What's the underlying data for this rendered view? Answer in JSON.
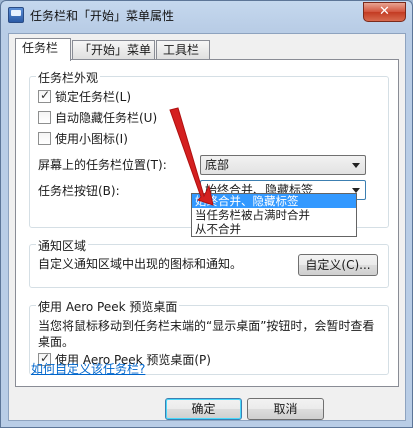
{
  "window": {
    "title": "任务栏和「开始」菜单属性",
    "close_symbol": "✕"
  },
  "tabs": [
    {
      "label": "任务栏",
      "active": true
    },
    {
      "label": "「开始」菜单",
      "active": false
    },
    {
      "label": "工具栏",
      "active": false
    }
  ],
  "appearance": {
    "group_title": "任务栏外观",
    "lock_taskbar": {
      "label": "锁定任务栏(L)",
      "checked": true
    },
    "auto_hide": {
      "label": "自动隐藏任务栏(U)",
      "checked": false
    },
    "small_icons": {
      "label": "使用小图标(I)",
      "checked": false
    },
    "location_label": "屏幕上的任务栏位置(T):",
    "location_value": "底部",
    "buttons_label": "任务栏按钮(B):",
    "buttons_value": "始终合并、隐藏标签",
    "buttons_options": [
      {
        "label": "始终合并、隐藏标签",
        "selected": true
      },
      {
        "label": "当任务栏被占满时合并",
        "selected": false
      },
      {
        "label": "从不合并",
        "selected": false
      }
    ]
  },
  "notification": {
    "group_title": "通知区域",
    "description": "自定义通知区域中出现的图标和通知。",
    "customize_button": "自定义(C)..."
  },
  "aero": {
    "group_title": "使用 Aero Peek 预览桌面",
    "description": "当您将鼠标移动到任务栏末端的“显示桌面”按钮时，会暂时查看桌面。",
    "checkbox": {
      "label": "使用 Aero Peek 预览桌面(P)",
      "checked": true
    }
  },
  "help_link": "如何自定义该任务栏?",
  "footer": {
    "ok": "确定",
    "cancel": "取消"
  },
  "colors": {
    "annotation_arrow": "#d42020",
    "selection": "#3399ff",
    "link": "#0066cc"
  }
}
